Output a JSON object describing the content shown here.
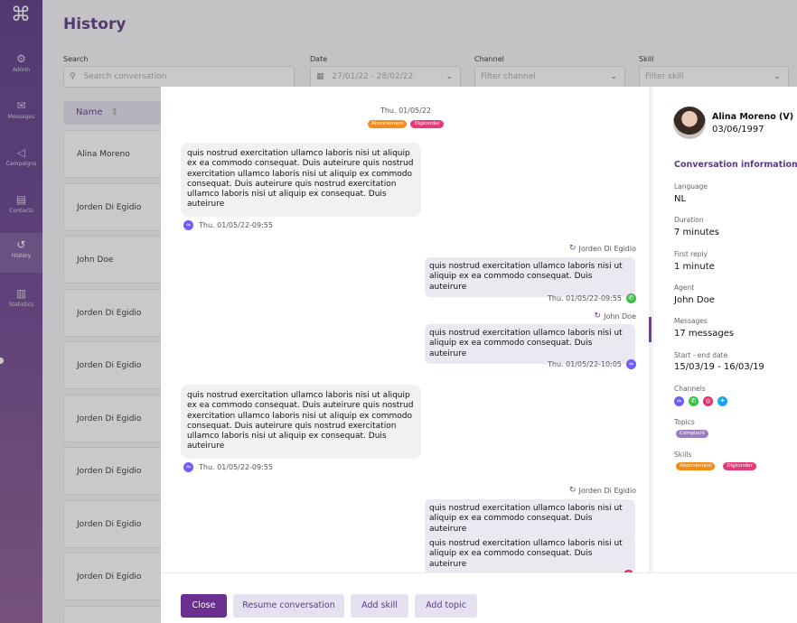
{
  "sidebar": {
    "items": [
      {
        "label": "Admin",
        "icon": "admin-icon"
      },
      {
        "label": "Messages",
        "icon": "messages-icon"
      },
      {
        "label": "Campaigns",
        "icon": "campaigns-icon"
      },
      {
        "label": "Contacts",
        "icon": "contacts-icon"
      },
      {
        "label": "History",
        "icon": "history-icon"
      },
      {
        "label": "Statistics",
        "icon": "statistics-icon"
      }
    ]
  },
  "page": {
    "title": "History",
    "filters": {
      "search_label": "Search",
      "search_placeholder": "Search conversation",
      "date_label": "Date",
      "date_value": "27/01/22 - 28/02/22",
      "channel_label": "Channel",
      "channel_placeholder": "Filter channel",
      "skill_label": "Skill",
      "skill_placeholder": "Filter skill"
    },
    "table": {
      "column_name": "Name",
      "rows": [
        "Alina Moreno",
        "Jorden Di Egidio",
        "John Doe",
        "Jorden Di Egidio",
        "Jorden Di Egidio",
        "Jorden Di Egidio",
        "Jorden Di Egidio",
        "Jorden Di Egidio",
        "Jorden Di Egidio"
      ]
    }
  },
  "conversation": {
    "date_header": "Thu. 01/05/22",
    "tags": [
      "Abonnement",
      "Digicorder"
    ],
    "long_text": "quis nostrud exercitation ullamco laboris nisi ut aliquip ex ea commodo consequat. Duis auteirure quis nostrud exercitation ullamco laboris nisi ut aliquip ex commodo consequat. Duis auteirure quis nostrud exercitation ullamco laboris nisi ut aliquip ex consequat. Duis auteirure",
    "short_text": "quis nostrud exercitation ullamco laboris nisi ut aliquip ex ea commodo consequat. Duis auteirure",
    "time_0955": "Thu. 01/05/22-09:55",
    "time_1005": "Thu. 01/05/22-10:05",
    "agent_jorden": "Jorden Di Egidio",
    "agent_john": "John Doe"
  },
  "customer": {
    "name": "Alina Moreno (V)",
    "dob": "03/06/1997"
  },
  "info": {
    "section_title": "Conversation information",
    "language_label": "Language",
    "language": "NL",
    "duration_label": "Duration",
    "duration": "7 minutes",
    "first_reply_label": "First reply",
    "first_reply": "1 minute",
    "agent_label": "Agent",
    "agent": "John Doe",
    "messages_label": "Messages",
    "messages": "17 messages",
    "period_label": "Start - end date",
    "period": "15/03/19 - 16/03/19",
    "channels_label": "Channels",
    "topics_label": "Topics",
    "topics": [
      "Complaint"
    ],
    "skills_label": "Skills",
    "skills": [
      "Abonnement",
      "Digicorder"
    ]
  },
  "footer": {
    "close": "Close",
    "resume": "Resume conversation",
    "add_skill": "Add skill",
    "add_topic": "Add topic"
  },
  "colors": {
    "brand": "#6b2f8f",
    "accent": "#5a3a86",
    "tag_orange": "#f28c1b",
    "tag_pink": "#e73a78"
  }
}
